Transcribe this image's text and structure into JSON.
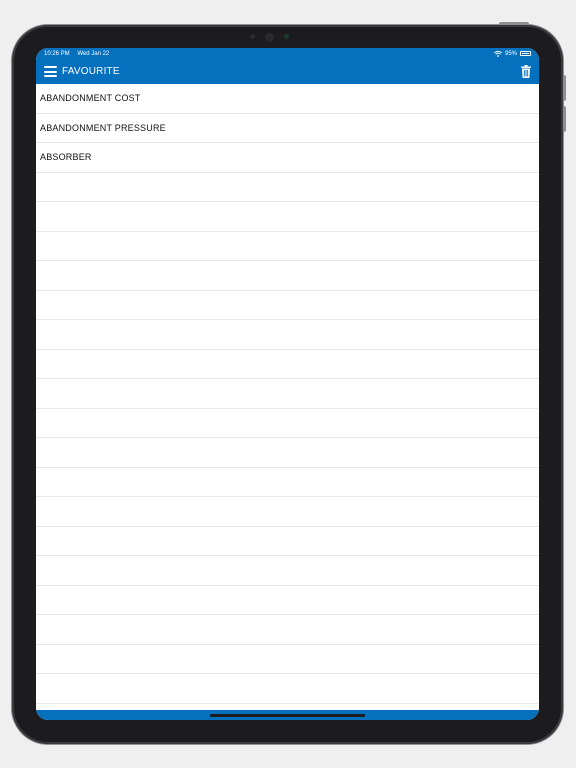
{
  "status_bar": {
    "time": "10:26 PM",
    "date": "Wed Jan 22",
    "battery": "95%",
    "wifi_icon": "wifi-icon",
    "battery_icon": "battery-icon"
  },
  "nav": {
    "menu_icon": "hamburger-menu-icon",
    "title": "FAVOURITE",
    "delete_icon": "trash-icon"
  },
  "favourites": [
    "ABANDONMENT COST",
    "ABANDONMENT PRESSURE",
    "ABSORBER"
  ],
  "colors": {
    "accent": "#0570bd",
    "background": "#ffffff",
    "divider": "#e7e7e7",
    "text": "#111111"
  }
}
